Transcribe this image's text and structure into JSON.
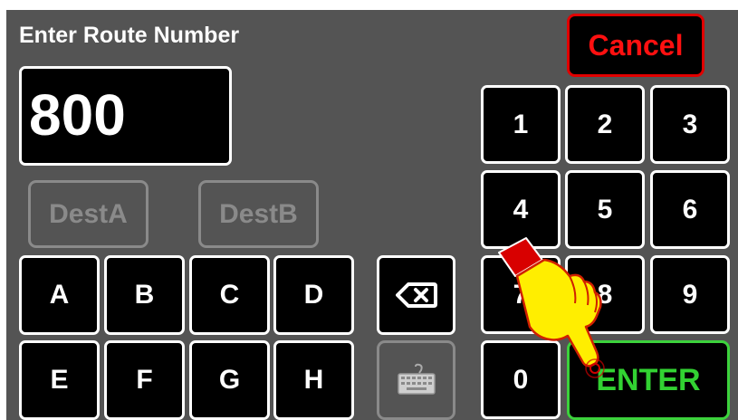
{
  "title": "Enter Route Number",
  "display_value": "800",
  "cancel_label": "Cancel",
  "enter_label": "ENTER",
  "dest_buttons": [
    "DestA",
    "DestB"
  ],
  "alpha_keys": [
    "A",
    "B",
    "C",
    "D",
    "E",
    "F",
    "G",
    "H"
  ],
  "num_keys": [
    "1",
    "2",
    "3",
    "4",
    "5",
    "6",
    "7",
    "8",
    "9",
    "0"
  ],
  "icons": {
    "backspace": "backspace-icon",
    "keyboard": "keyboard-icon",
    "hand": "pointing-hand-icon"
  },
  "colors": {
    "background": "#545454",
    "cancel": "#ff1010",
    "enter": "#32d232",
    "disabled": "#8a8a8a"
  }
}
